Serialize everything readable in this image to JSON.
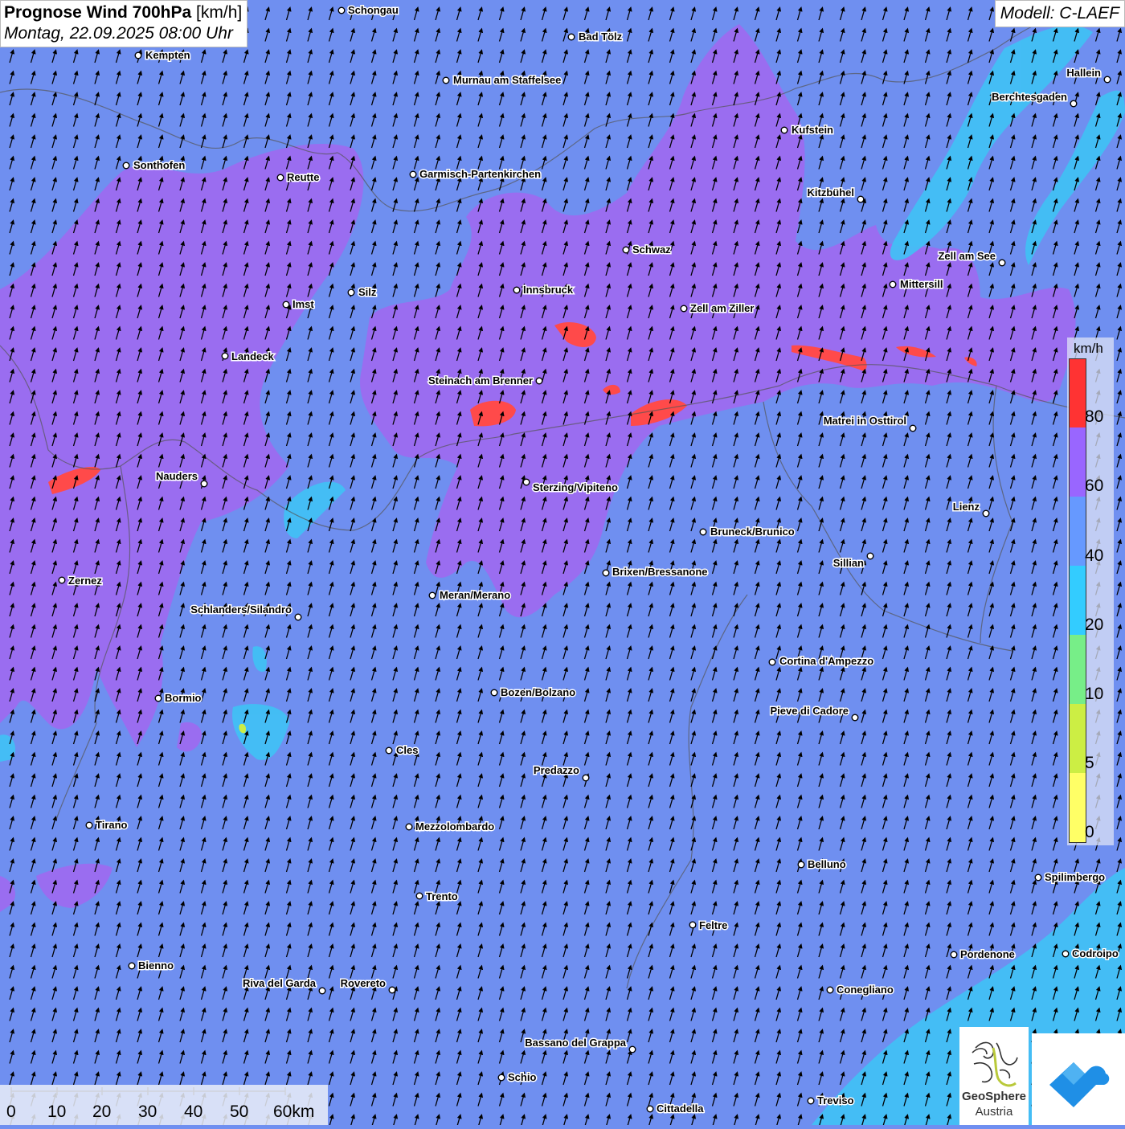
{
  "header": {
    "title": "Prognose Wind 700hPa",
    "unit": "[km/h]",
    "datetime": "Montag, 22.09.2025 08:00 Uhr"
  },
  "model": "Modell: C-LAEF",
  "legend": {
    "unit": "km/h",
    "labels": [
      "80",
      "60",
      "40",
      "20",
      "10",
      "5",
      "0"
    ],
    "colors": [
      "#ff3333",
      "#9966ff",
      "#6699ff",
      "#33ccff",
      "#77ee88",
      "#ccee44",
      "#ffff66"
    ]
  },
  "scale_bar": {
    "labels": [
      "0",
      "10",
      "20",
      "30",
      "40",
      "50",
      "60km"
    ]
  },
  "logos": {
    "geosphere_line1": "GeoSphere",
    "geosphere_line2": "Austria"
  },
  "cities": [
    {
      "name": "Schongau"
    },
    {
      "name": "Bad Tölz"
    },
    {
      "name": "Kempten"
    },
    {
      "name": "Murnau am Staffelsee"
    },
    {
      "name": "Hallein"
    },
    {
      "name": "Berchtesgaden"
    },
    {
      "name": "Kufstein"
    },
    {
      "name": "Sonthofen"
    },
    {
      "name": "Reutte"
    },
    {
      "name": "Garmisch-Partenkirchen"
    },
    {
      "name": "Kitzbühel"
    },
    {
      "name": "Schwaz"
    },
    {
      "name": "Zell am See"
    },
    {
      "name": "Mittersill"
    },
    {
      "name": "Innsbruck"
    },
    {
      "name": "Silz"
    },
    {
      "name": "Imst"
    },
    {
      "name": "Zell am Ziller"
    },
    {
      "name": "Landeck"
    },
    {
      "name": "Steinach am Brenner"
    },
    {
      "name": "Matrei in Osttirol"
    },
    {
      "name": "Nauders"
    },
    {
      "name": "Sterzing/Vipiteno"
    },
    {
      "name": "Lienz"
    },
    {
      "name": "Bruneck/Brunico"
    },
    {
      "name": "Sillian"
    },
    {
      "name": "Brixen/Bressanone"
    },
    {
      "name": "Zernez"
    },
    {
      "name": "Meran/Merano"
    },
    {
      "name": "Schlanders/Silandro"
    },
    {
      "name": "Cortina d'Ampezzo"
    },
    {
      "name": "Bozen/Bolzano"
    },
    {
      "name": "Bormio"
    },
    {
      "name": "Pieve di Cadore"
    },
    {
      "name": "Cles"
    },
    {
      "name": "Predazzo"
    },
    {
      "name": "Tirano"
    },
    {
      "name": "Mezzolombardo"
    },
    {
      "name": "Belluno"
    },
    {
      "name": "Spilimbergo"
    },
    {
      "name": "Trento"
    },
    {
      "name": "Feltre"
    },
    {
      "name": "Pordenone"
    },
    {
      "name": "Codroipo"
    },
    {
      "name": "Bienno"
    },
    {
      "name": "Riva del Garda"
    },
    {
      "name": "Rovereto"
    },
    {
      "name": "Conegliano"
    },
    {
      "name": "Bassano del Grappa"
    },
    {
      "name": "Schio"
    },
    {
      "name": "Treviso"
    },
    {
      "name": "Cittadella"
    }
  ]
}
